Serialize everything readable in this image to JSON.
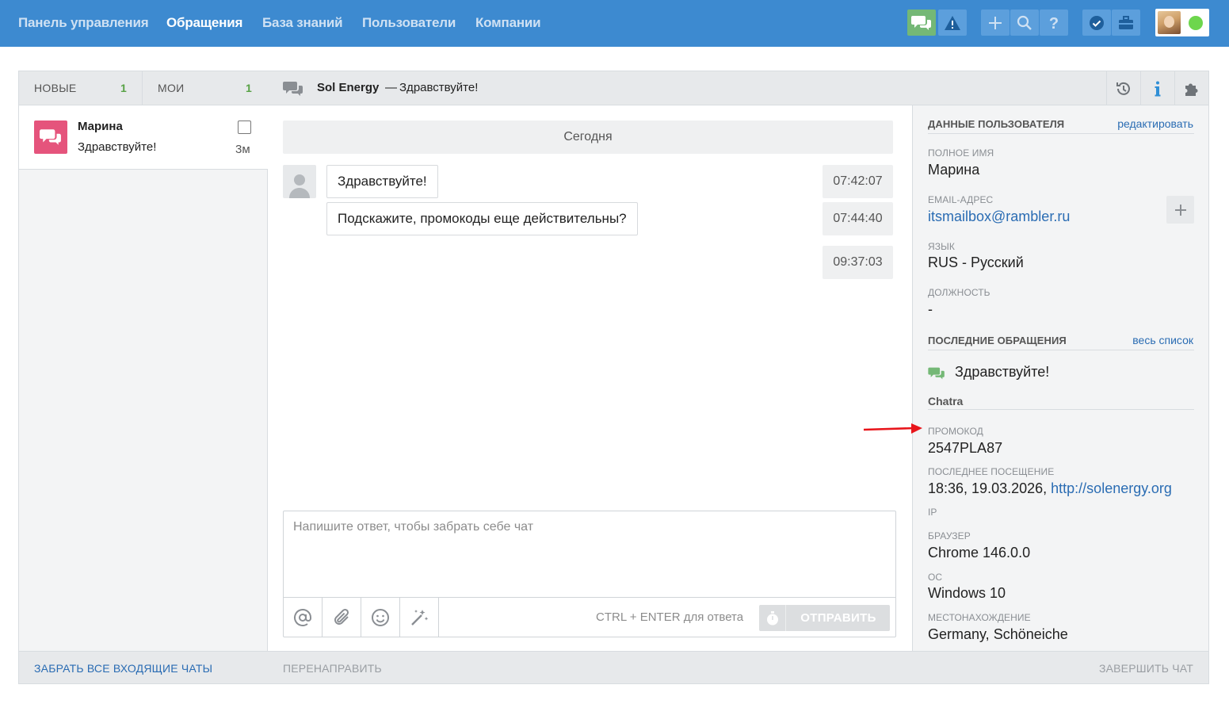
{
  "nav": {
    "items": [
      "Панель управления",
      "Обращения",
      "База знаний",
      "Пользователи",
      "Компании"
    ],
    "active_index": 1,
    "accent": "#3d8ad0"
  },
  "toolbar": {
    "icons": [
      "chats-icon",
      "warning-icon",
      "plus-icon",
      "search-icon",
      "help-icon",
      "verified-icon",
      "briefcase-icon"
    ],
    "status": "online"
  },
  "tabs": {
    "new": {
      "label": "НОВЫЕ",
      "count": "1"
    },
    "mine": {
      "label": "МОИ",
      "count": "1"
    }
  },
  "chat_list": {
    "items": [
      {
        "name": "Марина",
        "message": "Здравствуйте!",
        "time": "3м"
      }
    ]
  },
  "conversation": {
    "company": "Sol Energy",
    "dash": "—",
    "subject": "Здравствуйте!",
    "date_separator": "Сегодня",
    "messages": [
      {
        "text": "Здравствуйте!",
        "time": "07:42:07"
      },
      {
        "text": "Подскажите, промокоды еще действительны?",
        "time": "07:44:40"
      },
      {
        "text": "",
        "time": "09:37:03"
      }
    ]
  },
  "composer": {
    "placeholder": "Напишите ответ, чтобы забрать себе чат",
    "hint": "CTRL + ENTER для ответа",
    "send_label": "ОТПРАВИТЬ"
  },
  "footer": {
    "take_all": "ЗАБРАТЬ ВСЕ ВХОДЯЩИЕ ЧАТЫ",
    "forward": "ПЕРЕНАПРАВИТЬ",
    "finish": "ЗАВЕРШИТЬ ЧАТ"
  },
  "user_panel": {
    "title": "ДАННЫЕ ПОЛЬЗОВАТЕЛЯ",
    "edit_link": "редактировать",
    "fields": {
      "full_name": {
        "label": "ПОЛНОЕ ИМЯ",
        "value": "Марина"
      },
      "email": {
        "label": "EMAIL-АДРЕС",
        "value": "itsmailbox@rambler.ru"
      },
      "language": {
        "label": "ЯЗЫК",
        "value": "RUS - Русский"
      },
      "position": {
        "label": "ДОЛЖНОСТЬ",
        "value": "-"
      }
    },
    "recent": {
      "title": "ПОСЛЕДНИЕ ОБРАЩЕНИЯ",
      "link": "весь список",
      "items": [
        "Здравствуйте!"
      ]
    },
    "chatra": {
      "title": "Chatra",
      "promo": {
        "label": "ПРОМОКОД",
        "value": "2547PLA87"
      },
      "last_visit": {
        "label": "ПОСЛЕДНЕЕ ПОСЕЩЕНИЕ",
        "value": "18:36, 19.03.2026,",
        "link": "http://solenergy.org"
      },
      "ip": {
        "label": "IP",
        "value": ""
      },
      "browser": {
        "label": "БРАУЗЕР",
        "value": "Chrome 146.0.0"
      },
      "os": {
        "label": "ОС",
        "value": "Windows 10"
      },
      "location": {
        "label": "МЕСТОНАХОЖДЕНИЕ",
        "value": "Germany, Schöneiche"
      }
    }
  }
}
